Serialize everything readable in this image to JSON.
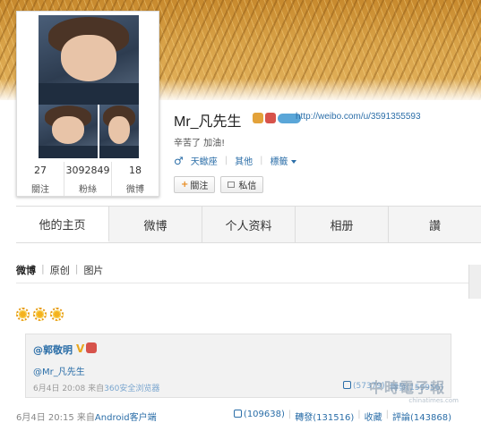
{
  "profile": {
    "name": "Mr_凡先生",
    "url": "http://weibo.com/u/3591355593",
    "intro": "辛苦了 加油!",
    "gender_symbol": "♂",
    "meta": {
      "zodiac": "天蠍座",
      "other": "其他",
      "tags": "標籤"
    },
    "stats": [
      {
        "num": "27",
        "label": "關注"
      },
      {
        "num": "3092849",
        "label": "粉絲"
      },
      {
        "num": "18",
        "label": "微博"
      }
    ],
    "follow_button": "關注",
    "message_button": "私信"
  },
  "tabs": [
    "他的主页",
    "微博",
    "个人资料",
    "相册",
    "讚"
  ],
  "filter": {
    "active": "微博",
    "items": [
      "原创",
      "图片"
    ]
  },
  "post": {
    "quote": {
      "author": "@郭敬明",
      "verified": "V",
      "mention": "@Mr_凡先生",
      "time": "6月4日 20:08",
      "from": "来自",
      "source": "360安全浏览器",
      "likes": "(57379)",
      "reposts": "轉發(159956)"
    },
    "time": "6月4日 20:15",
    "from": "来自",
    "source": "Android客户端",
    "likes": "(109638)",
    "reposts": "轉發(131516)",
    "favorite": "收藏",
    "comments": "評論(143868)"
  },
  "watermark": {
    "text": "中時電子報",
    "sub": "chinatimes.com"
  }
}
